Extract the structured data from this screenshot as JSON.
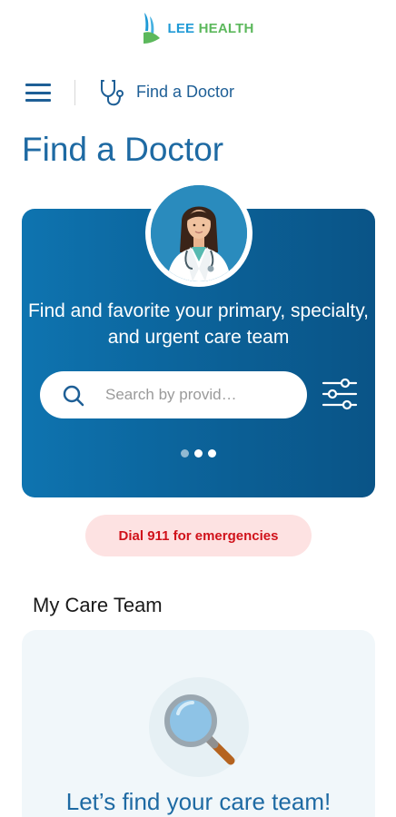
{
  "brand": {
    "lee": "LEE",
    "health": "HEALTH"
  },
  "nav": {
    "title": "Find a Doctor"
  },
  "page": {
    "title": "Find a Doctor"
  },
  "hero": {
    "headline": "Find and favorite your primary, specialty, and urgent care team",
    "search_placeholder": "Search by provid…",
    "carousel": {
      "pages": 3,
      "active_index": 2
    }
  },
  "emergency": {
    "label": "Dial 911 for emergencies"
  },
  "care_team": {
    "section_title": "My Care Team",
    "cta": "Let’s find your care team!"
  },
  "colors": {
    "primary_blue": "#1e6aa3",
    "hero_blue": "#0b5f95",
    "emergency_red": "#d0121b",
    "emergency_bg": "#fde2e2",
    "logo_green": "#5cb85c",
    "logo_blue": "#1f9ad6"
  },
  "icons": [
    "logo-icon",
    "hamburger-menu-icon",
    "stethoscope-icon",
    "doctor-avatar-icon",
    "search-icon",
    "filter-sliders-icon",
    "magnifier-illustration-icon"
  ]
}
